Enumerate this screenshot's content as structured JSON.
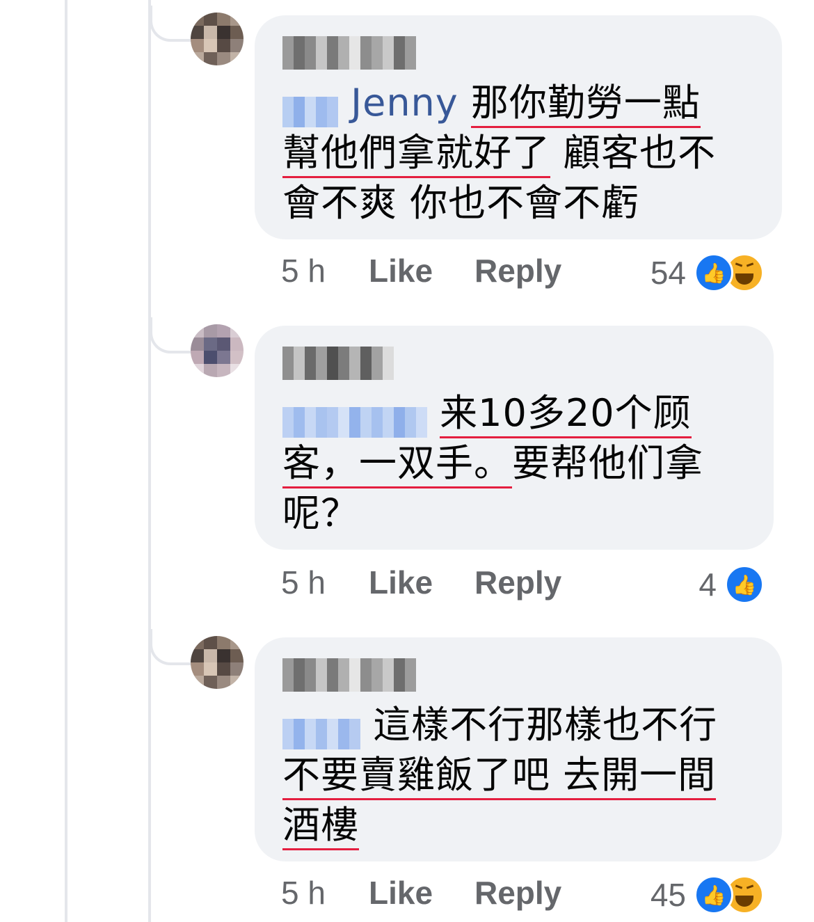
{
  "comments": [
    {
      "author_label": "Mo Ling",
      "lines": [
        [
          {
            "t": "@mention",
            "mention": "Jenny"
          },
          {
            "t": "那你勤勞一點",
            "u": true
          }
        ],
        [
          {
            "t": "幫他們拿就好了",
            "u": true
          },
          {
            "t": " 顧客也不"
          }
        ],
        [
          {
            "t": "會不爽 你也不會不虧"
          }
        ]
      ],
      "time": "5 h",
      "like_label": "Like",
      "reply_label": "Reply",
      "reaction_count": "54",
      "reactions": [
        "like-icon",
        "haha-icon"
      ]
    },
    {
      "author_label": "",
      "lines": [
        [
          {
            "t": "@mention",
            "mention": ""
          },
          {
            "t": "来10多20个顾",
            "u": true
          }
        ],
        [
          {
            "t": "客，一双手。",
            "u": true
          },
          {
            "t": "要帮他们拿"
          }
        ],
        [
          {
            "t": "呢？"
          }
        ]
      ],
      "time": "5 h",
      "like_label": "Like",
      "reply_label": "Reply",
      "reaction_count": "4",
      "reactions": [
        "like-icon"
      ]
    },
    {
      "author_label": "Mo Ling",
      "lines": [
        [
          {
            "t": "@mention",
            "mention": ""
          },
          {
            "t": " 這樣不行那樣也不行"
          }
        ],
        [
          {
            "t": "不要賣雞飯了吧 去開一間",
            "u": true
          }
        ],
        [
          {
            "t": "酒樓",
            "u": true
          }
        ]
      ],
      "time": "5 h",
      "like_label": "Like",
      "reply_label": "Reply",
      "reaction_count": "45",
      "reactions": [
        "like-icon",
        "haha-icon"
      ]
    }
  ],
  "colors": {
    "bubble": "#f0f2f5",
    "mention": "#385898",
    "underline": "#e41e3f",
    "meta": "#65676b",
    "like": "#1877f2",
    "haha": "#f7b125"
  }
}
